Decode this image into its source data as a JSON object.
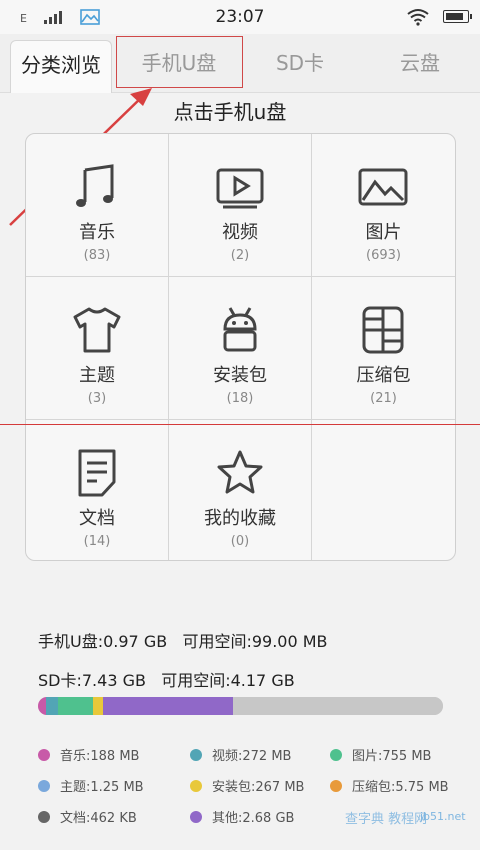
{
  "status": {
    "carrier": "E",
    "time": "23:07"
  },
  "tabs": [
    {
      "label": "分类浏览"
    },
    {
      "label": "手机U盘"
    },
    {
      "label": "SD卡"
    },
    {
      "label": "云盘"
    }
  ],
  "annotation": "点击手机u盘",
  "categories": [
    {
      "label": "音乐",
      "count": "(83)",
      "icon": "music-icon"
    },
    {
      "label": "视频",
      "count": "(2)",
      "icon": "video-icon"
    },
    {
      "label": "图片",
      "count": "(693)",
      "icon": "image-icon"
    },
    {
      "label": "主题",
      "count": "(3)",
      "icon": "theme-icon"
    },
    {
      "label": "安装包",
      "count": "(18)",
      "icon": "android-icon"
    },
    {
      "label": "压缩包",
      "count": "(21)",
      "icon": "archive-icon"
    },
    {
      "label": "文档",
      "count": "(14)",
      "icon": "document-icon"
    },
    {
      "label": "我的收藏",
      "count": "(0)",
      "icon": "star-icon"
    }
  ],
  "storage": {
    "phone": "手机U盘:0.97 GB   可用空间:99.00 MB",
    "sd": "SD卡:7.43 GB   可用空间:4.17 GB"
  },
  "colors": {
    "music": "#c85aa8",
    "video": "#52a5b5",
    "image": "#4fc18e",
    "theme": "#7aa8dc",
    "apk": "#e8c83a",
    "zip": "#e89a3a",
    "doc": "#666666",
    "other": "#9068c8",
    "free": "#c7c7c7"
  },
  "legend": [
    {
      "text": "音乐:188 MB",
      "color": "#c85aa8"
    },
    {
      "text": "视频:272 MB",
      "color": "#52a5b5"
    },
    {
      "text": "图片:755 MB",
      "color": "#4fc18e"
    },
    {
      "text": "主题:1.25 MB",
      "color": "#7aa8dc"
    },
    {
      "text": "安装包:267 MB",
      "color": "#e8c83a"
    },
    {
      "text": "压缩包:5.75 MB",
      "color": "#e89a3a"
    },
    {
      "text": "文档:462 KB",
      "color": "#666666"
    },
    {
      "text": "其他:2.68 GB",
      "color": "#9068c8"
    }
  ],
  "watermark": {
    "line1": "查字典 教程网",
    "line2": "jb51.net"
  }
}
